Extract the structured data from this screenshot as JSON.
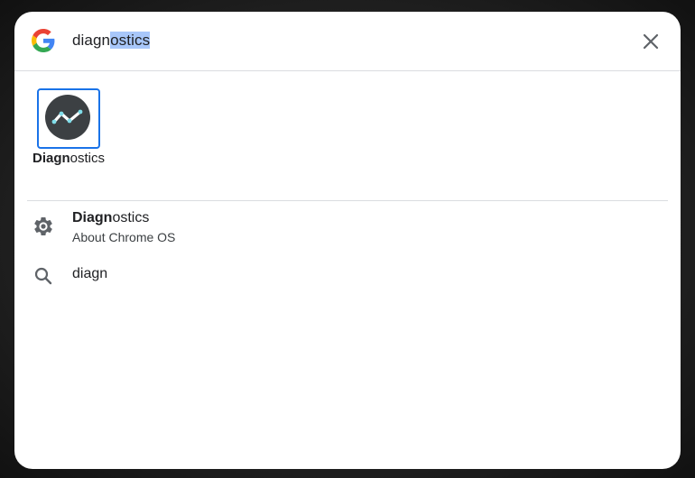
{
  "search": {
    "query_typed": "diagn",
    "query_autocomplete": "ostics"
  },
  "app_tile": {
    "label_match": "Diagn",
    "label_rest": "ostics",
    "icon": "diagnostics-app-icon"
  },
  "results": [
    {
      "title_match": "Diagn",
      "title_rest": "ostics",
      "subtitle": "About Chrome OS",
      "icon": "settings-gear-icon"
    },
    {
      "title": "diagn",
      "icon": "search-icon"
    }
  ],
  "colors": {
    "focus_ring": "#1a73e8",
    "selection": "#a8c7fa",
    "icon_gray": "#5f6368",
    "app_icon_bg": "#3c4043",
    "app_icon_line": "#ffffff",
    "app_icon_dots": "#80deea"
  }
}
